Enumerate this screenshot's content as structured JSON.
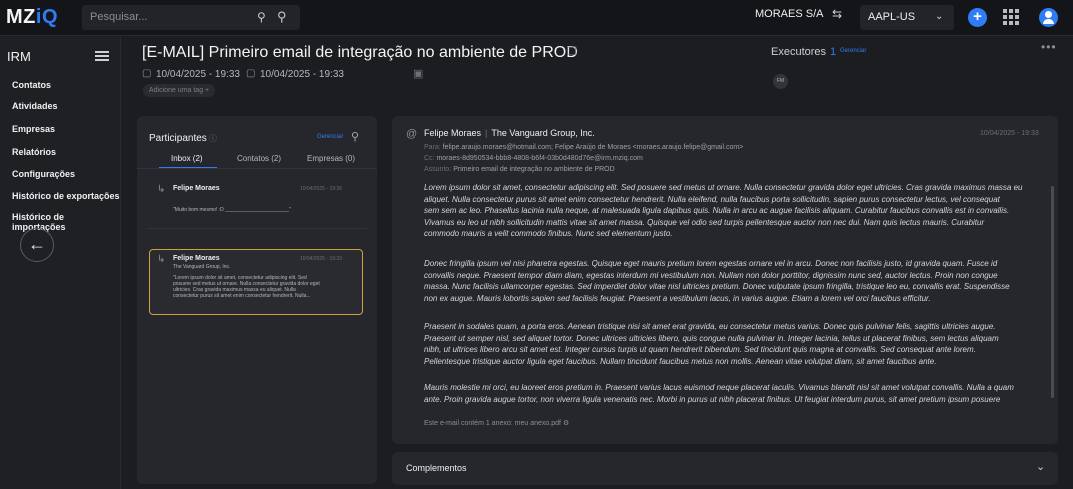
{
  "topbar": {
    "logo_main": "MZ",
    "logo_accent": "iQ",
    "search_placeholder": "Pesquisar...",
    "company": "MORAES S/A",
    "ticker": "AAPL-US"
  },
  "sidebar": {
    "title": "IRM",
    "items": [
      "Contatos",
      "Atividades",
      "Empresas",
      "Relatórios",
      "Configurações",
      "Histórico de exportações",
      "Histórico de importações"
    ]
  },
  "header": {
    "title": "[E-MAIL] Primeiro email de integração no ambiente de PROD",
    "start_date": "10/04/2025 - 19:33",
    "end_date": "10/04/2025 - 19:33",
    "add_tag": "Adicione uma tag +"
  },
  "executors": {
    "label": "Executores",
    "count": "1",
    "manage": "Gerenciar",
    "avatar": "FM"
  },
  "participants": {
    "title": "Participantes",
    "manage": "Gerenciar",
    "tabs": [
      "Inbox (2)",
      "Contatos (2)",
      "Empresas (0)"
    ],
    "messages": [
      {
        "name": "Felipe Moraes",
        "date": "10/04/2025 - 19:36",
        "text": "\"Muito bom mesmo! :D _______________________\""
      },
      {
        "name": "Felipe Moraes",
        "company": "The Vanguard Group, Inc.",
        "date": "10/04/2025 - 19:33",
        "text_lines": [
          "\"Lorem ipsum dolor sit amet, consectetur adipiscing elit. Sed",
          "posuere sed metus ut ornare. Nulla consectetur gravida dolor eget",
          "ultricies. Cras gravida maximus massa eu aliquet. Nulla",
          "consectetur purus sit amet enim consectetur hendrerit. Nulla..."
        ]
      }
    ]
  },
  "email": {
    "from_name": "Felipe Moraes",
    "from_company": "The Vanguard Group, Inc.",
    "date": "10/04/2025 - 19:33",
    "to_label": "Para:",
    "to": "felipe.araujo.moraes@hotmail.com;  Felipe Araújo de Moraes <moraes.araujo.felipe@gmail.com>",
    "cc_label": "Cc:",
    "cc": "moraes-8d950534-bbb8-4808-b6f4-03b0d480d76e@irm.mziq.com",
    "subject_label": "Assunto:",
    "subject": "Primeiro email de integração no ambiente de PROD",
    "paragraphs": [
      [
        "Lorem ipsum dolor sit amet, consectetur adipiscing elit. Sed posuere sed metus ut ornare. Nulla consectetur gravida dolor eget ultricies. Cras gravida maximus massa eu",
        "aliquet. Nulla consectetur purus sit amet enim consectetur hendrerit. Nulla eleifend, nulla faucibus porta sollicitudin, sapien purus consectetur lectus, vel consequat",
        "sem sem ac leo. Phasellus lacinia nulla neque, at malesuada ligula dapibus quis. Nulla in arcu ac augue facilisis aliquam. Curabitur faucibus convallis est in convallis.",
        "Vivamus eu leo ut nibh sollicitudin mattis vitae sit amet massa. Quisque vel odio sed turpis pellentesque auctor non nec dui. Nam quis lectus mauris. Curabitur",
        "commodo mauris a velit commodo finibus. Nunc sed elementum justo."
      ],
      [
        "Donec fringilla ipsum vel nisi pharetra egestas. Quisque eget mauris pretium lorem egestas ornare vel in arcu. Donec non facilisis justo, id gravida quam. Fusce id",
        "convallis neque. Praesent tempor diam diam, egestas interdum mi vestibulum non. Nullam non dolor porttitor, dignissim nunc sed, auctor lectus. Proin non congue",
        "massa. Nunc facilisis ullamcorper egestas. Sed imperdiet dolor vitae nisl ultricies pretium. Donec vulputate ipsum fringilla, tristique leo eu, convallis erat. Suspendisse",
        "non ex augue. Mauris lobortis sapien sed facilisis feugiat. Praesent a vestibulum lacus, in varius augue. Etiam a lorem vel orci faucibus efficitur."
      ],
      [
        "Praesent in sodales quam, a porta eros. Aenean tristique nisi sit amet erat gravida, eu consectetur metus varius. Donec quis pulvinar felis, sagittis ultricies augue.",
        "Praesent ut semper nisl, sed aliquet tortor. Donec ultrices ultricies libero, quis congue nulla pulvinar in. Integer lacinia, tellus ut placerat finibus, sem lectus aliquam",
        "nibh, ut ultrices libero arcu sit amet est. Integer cursus turpis ut quam hendrerit bibendum. Sed tincidunt quis magna at convallis. Sed consequat ante lorem.",
        "Pellentesque tristique auctor ligula eget faucibus. Nullam tincidunt faucibus metus non mollis. Aenean vitae volutpat diam, sit amet faucibus ante."
      ],
      [
        "Mauris molestie mi orci, eu laoreet eros pretium in. Praesent varius lacus euismod neque placerat iaculis. Vivamus blandit nisl sit amet volutpat convallis. Nulla a quam",
        "ante. Proin gravida augue tortor, non viverra ligula venenatis nec. Morbi in purus ut nibh placerat finibus. Ut feugiat interdum purus, sit amet pretium ipsum posuere"
      ]
    ],
    "attachment": "Este e-mail contém 1 anexo: meu anexo.pdf"
  },
  "complementos": {
    "label": "Complementos"
  },
  "colors": {
    "accent": "#2f7df6",
    "highlight_border": "#c9a43a",
    "background": "#1c1d20",
    "panel": "#26272c"
  },
  "icons": [
    "pin-icon",
    "search-icon",
    "swap-icon",
    "chevron-down-icon",
    "plus-icon",
    "apps-grid-icon",
    "user-icon",
    "menu-icon",
    "arrow-left-icon",
    "calendar-icon",
    "copy-icon",
    "reply-arrow-icon",
    "at-icon",
    "info-icon",
    "more-icon"
  ]
}
